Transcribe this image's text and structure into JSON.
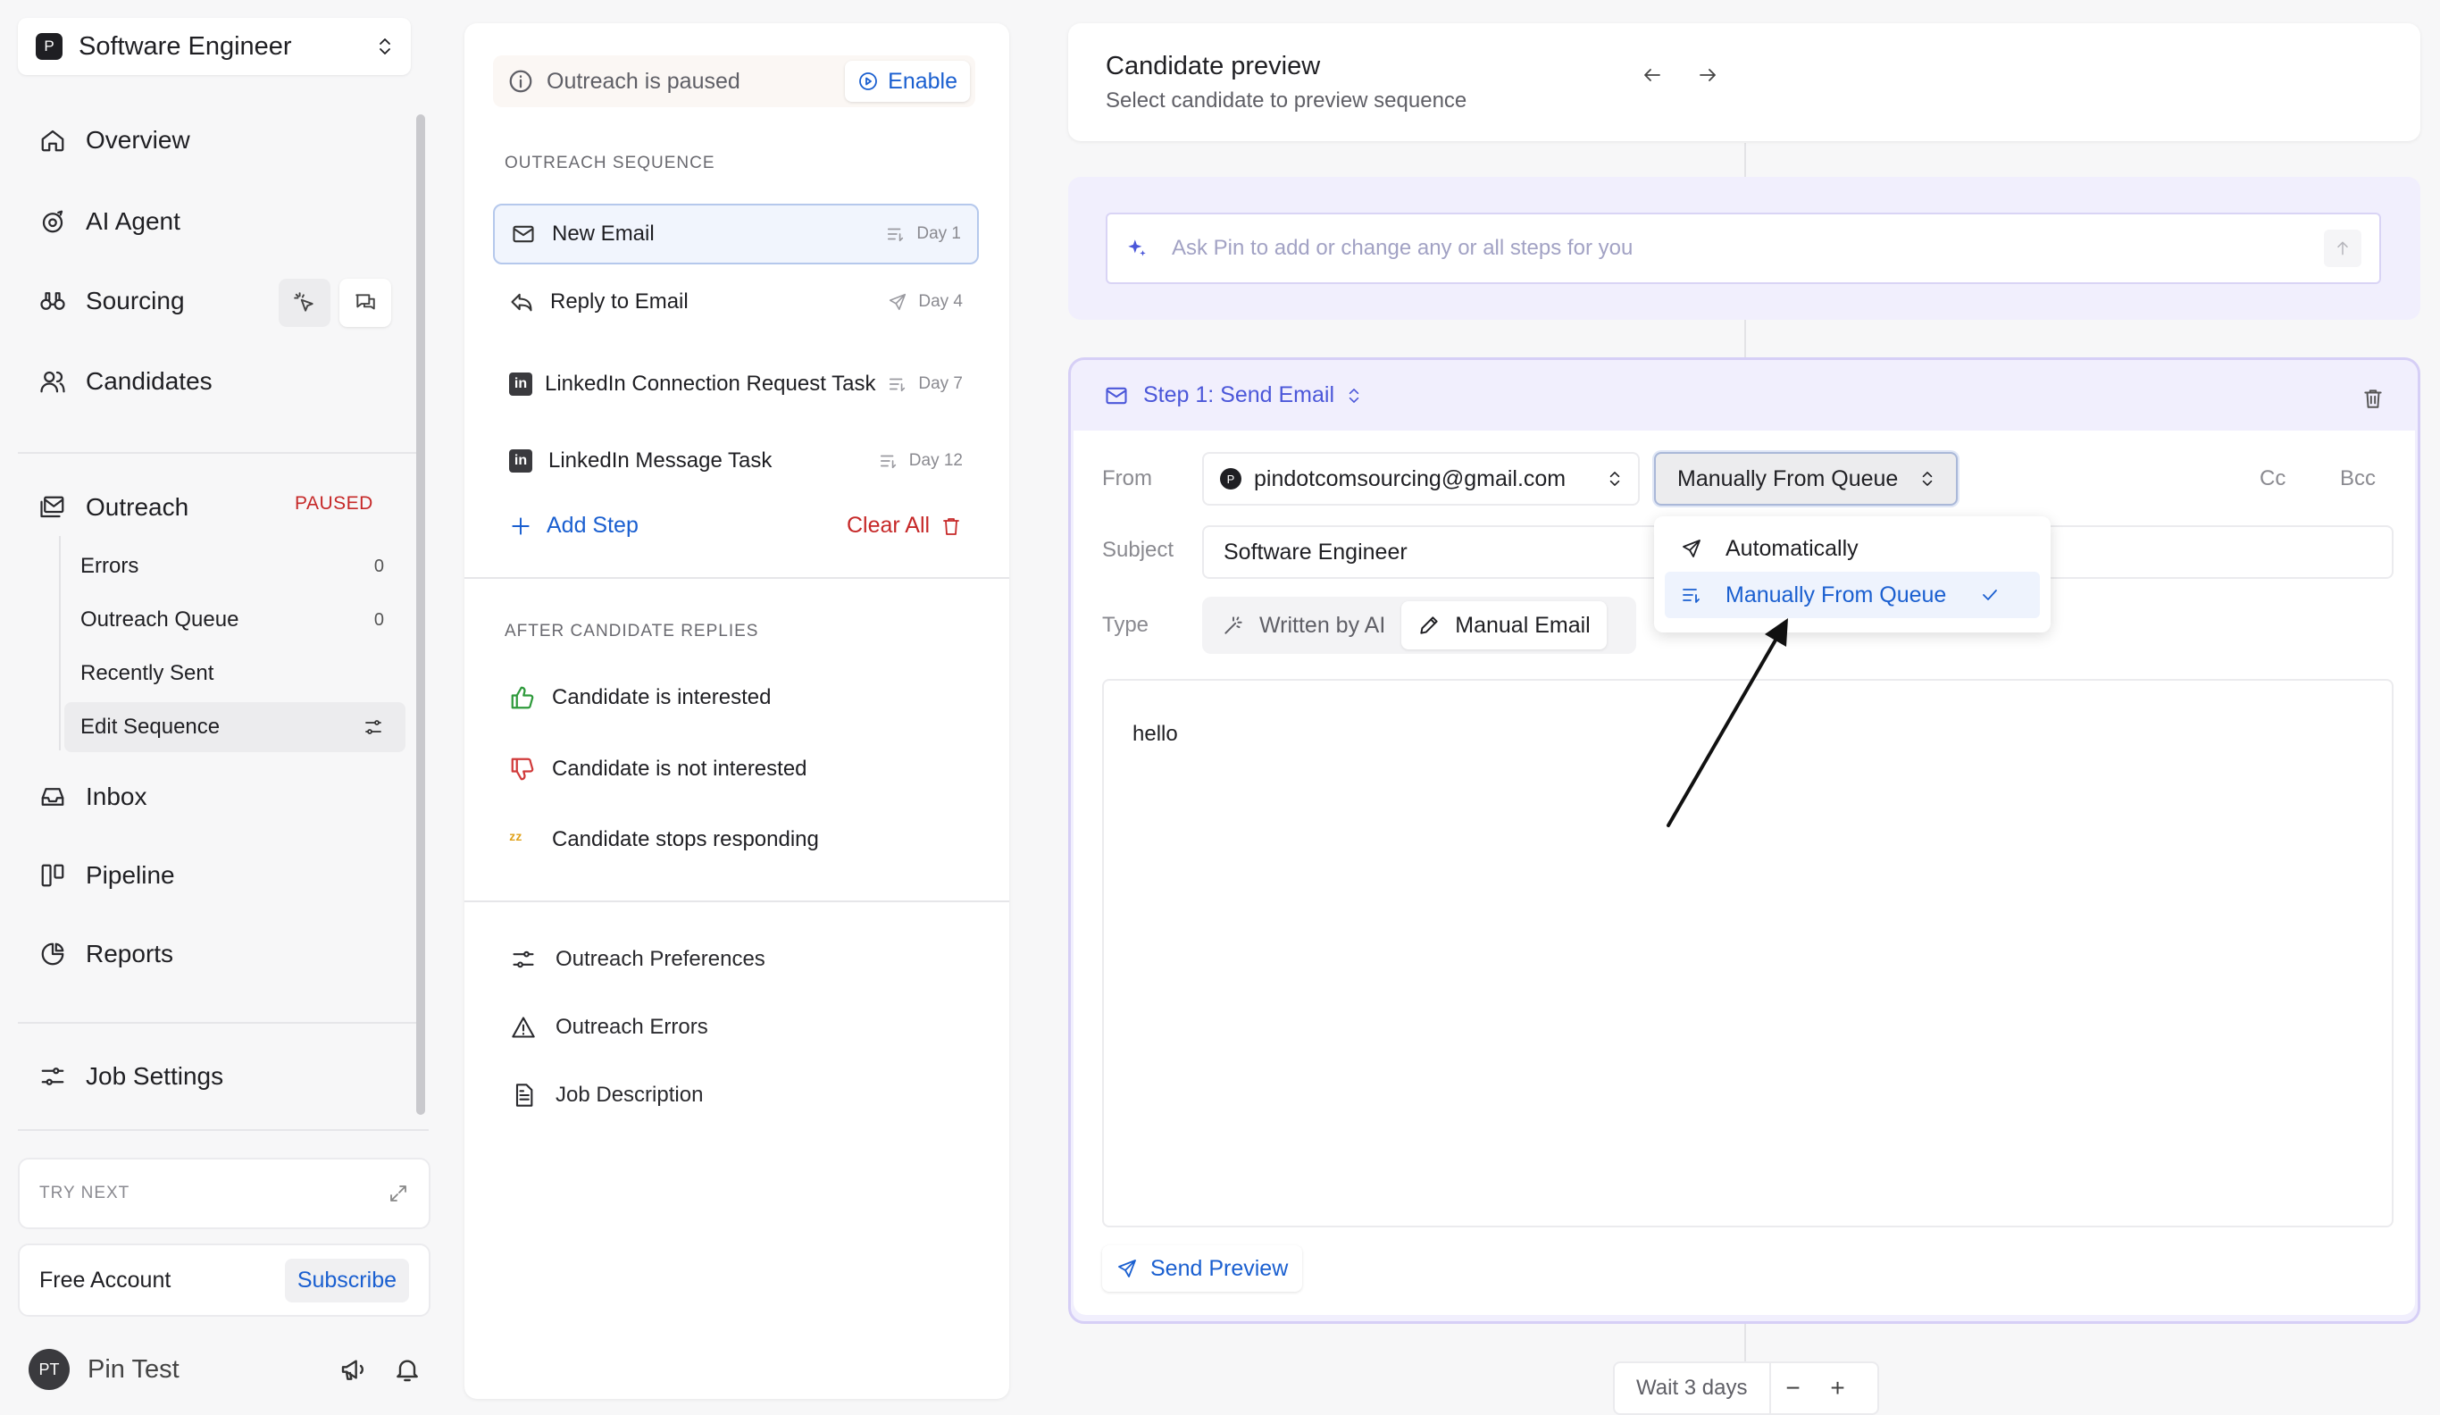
{
  "sidebar": {
    "job": {
      "badge": "P",
      "title": "Software Engineer"
    },
    "nav": {
      "overview": "Overview",
      "ai_agent": "AI Agent",
      "sourcing": "Sourcing",
      "candidates": "Candidates",
      "outreach": "Outreach",
      "outreach_status": "PAUSED",
      "inbox": "Inbox",
      "pipeline": "Pipeline",
      "reports": "Reports",
      "job_settings": "Job Settings"
    },
    "outreach_sub": [
      {
        "label": "Errors",
        "count": "0"
      },
      {
        "label": "Outreach Queue",
        "count": "0"
      },
      {
        "label": "Recently Sent",
        "count": ""
      },
      {
        "label": "Edit Sequence",
        "count": ""
      }
    ],
    "try_next": "TRY NEXT",
    "account": {
      "plan": "Free Account",
      "subscribe": "Subscribe"
    },
    "user": {
      "initials": "PT",
      "name": "Pin Test"
    }
  },
  "sequence_panel": {
    "paused_text": "Outreach is paused",
    "enable_label": "Enable",
    "section_sequence": "OUTREACH SEQUENCE",
    "steps": [
      {
        "label": "New Email",
        "day": "Day 1"
      },
      {
        "label": "Reply to Email",
        "day": "Day 4"
      },
      {
        "label": "LinkedIn Connection Request Task",
        "day": "Day 7"
      },
      {
        "label": "LinkedIn Message Task",
        "day": "Day 12"
      }
    ],
    "add_step": "Add Step",
    "clear_all": "Clear All",
    "section_replies": "AFTER CANDIDATE REPLIES",
    "replies": [
      "Candidate is interested",
      "Candidate is not interested",
      "Candidate stops responding"
    ],
    "links": [
      "Outreach Preferences",
      "Outreach Errors",
      "Job Description"
    ]
  },
  "preview": {
    "title": "Candidate preview",
    "subtitle": "Select candidate to preview sequence"
  },
  "ask_pin": {
    "placeholder": "Ask Pin to add or change any or all steps for you"
  },
  "step": {
    "title": "Step 1: Send Email",
    "from_label": "From",
    "from_badge": "P",
    "from_value": "pindotcomsourcing@gmail.com",
    "mode_value": "Manually From Queue",
    "cc": "Cc",
    "bcc": "Bcc",
    "subject_label": "Subject",
    "subject_value": "Software Engineer",
    "type_label": "Type",
    "type_options": [
      "Written by AI",
      "Manual Email"
    ],
    "body": "hello",
    "send_preview": "Send Preview",
    "dropdown_options": [
      "Automatically",
      "Manually From Queue"
    ]
  },
  "wait": {
    "label": "Wait 3 days",
    "minus": "−",
    "plus": "+"
  },
  "colors": {
    "accent": "#1a5fd0",
    "ai_purple": "#4b57d9",
    "danger": "#c62828"
  }
}
